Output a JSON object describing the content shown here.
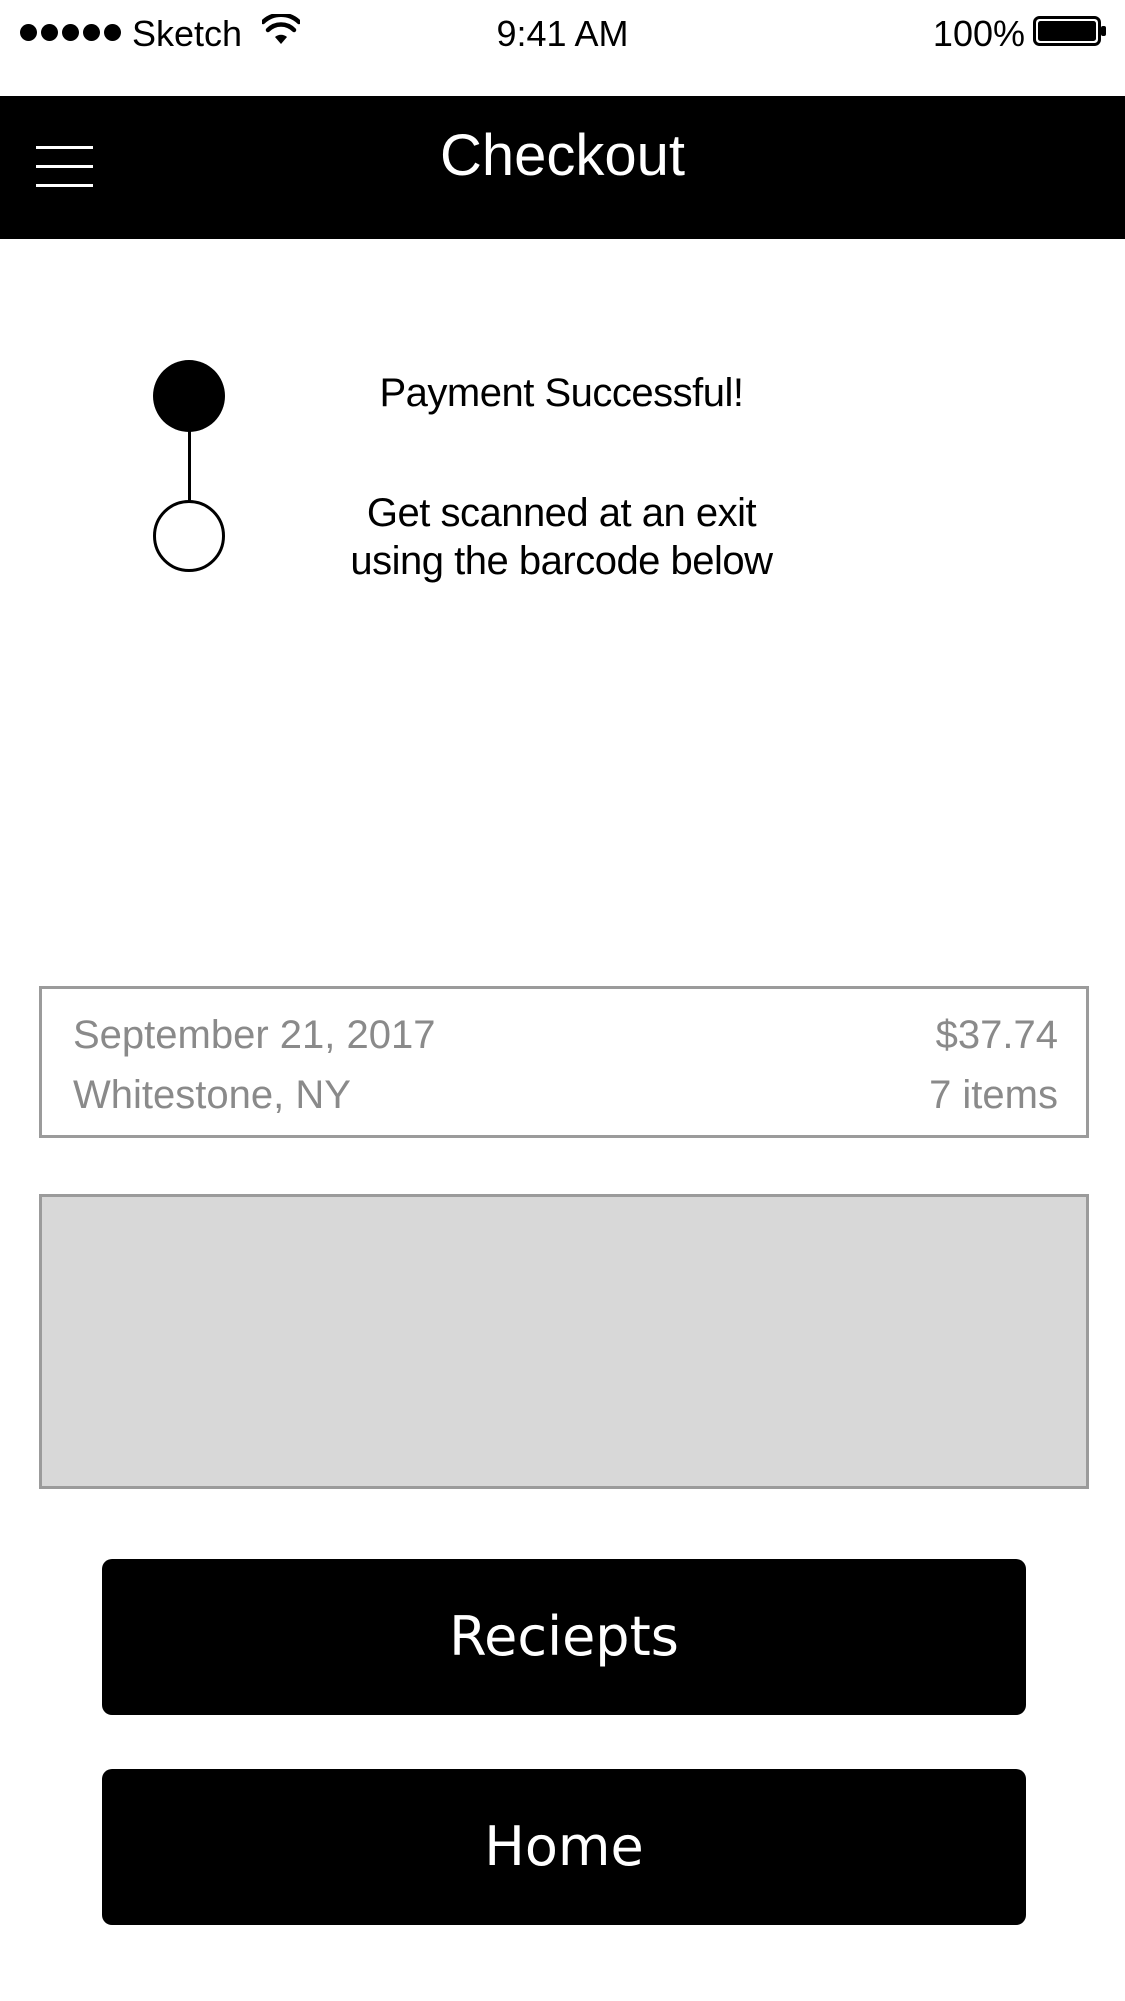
{
  "status_bar": {
    "carrier": "Sketch",
    "time": "9:41 AM",
    "battery": "100%"
  },
  "header": {
    "title": "Checkout",
    "menu_icon": "hamburger-menu-icon"
  },
  "progress": {
    "steps": [
      {
        "label": "Payment Successful!",
        "state": "complete"
      },
      {
        "label_line1": "Get scanned at an exit",
        "label_line2": "using the barcode below",
        "state": "pending"
      }
    ]
  },
  "order": {
    "date": "September 21, 2017",
    "total": "$37.74",
    "location": "Whitestone, NY",
    "item_count": "7 items"
  },
  "buttons": {
    "receipts": "Reciepts",
    "home": "Home"
  },
  "colors": {
    "primary": "#000000",
    "on_primary": "#ffffff",
    "muted_text": "#8a8a8a",
    "card_border": "#9b9b9b",
    "barcode_placeholder": "#d8d8d8"
  }
}
